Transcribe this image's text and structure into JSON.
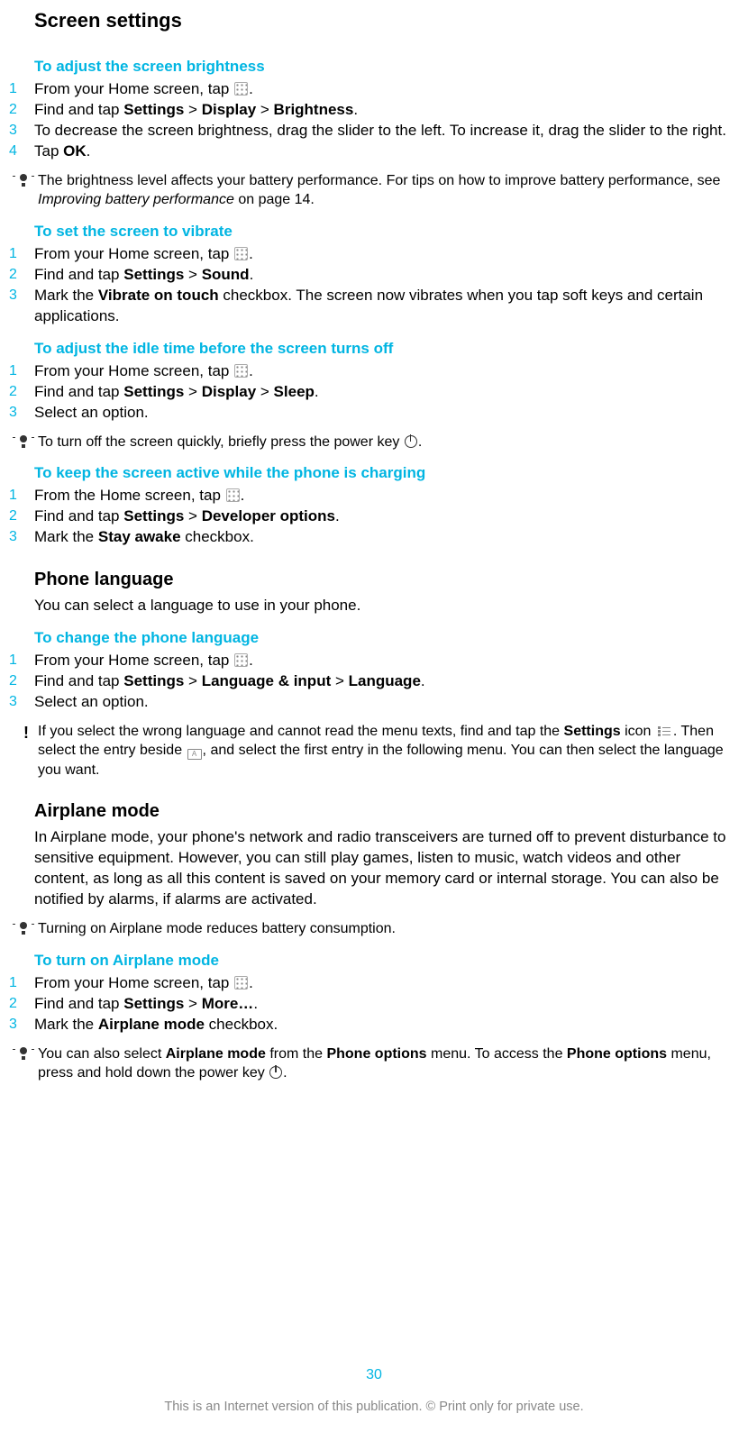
{
  "pageTitle": "Screen settings",
  "sections": [
    {
      "heading": "To adjust the screen brightness",
      "steps": [
        {
          "num": "1",
          "pre": "From your Home screen, tap ",
          "icon": "apps",
          "post": "."
        },
        {
          "num": "2",
          "html": "Find and tap <b>Settings</b> > <b>Display</b> > <b>Brightness</b>."
        },
        {
          "num": "3",
          "text": "To decrease the screen brightness, drag the slider to the left. To increase it, drag the slider to the right."
        },
        {
          "num": "4",
          "html": "Tap <b>OK</b>."
        }
      ],
      "tip": {
        "type": "bulb",
        "html": "The brightness level affects your battery performance. For tips on how to improve battery performance, see <i>Improving battery performance</i> on page 14."
      }
    },
    {
      "heading": "To set the screen to vibrate",
      "steps": [
        {
          "num": "1",
          "pre": "From your Home screen, tap ",
          "icon": "apps",
          "post": "."
        },
        {
          "num": "2",
          "html": "Find and tap <b>Settings</b> > <b>Sound</b>."
        },
        {
          "num": "3",
          "html": "Mark the <b>Vibrate on touch</b> checkbox. The screen now vibrates when you tap soft keys and certain applications."
        }
      ]
    },
    {
      "heading": "To adjust the idle time before the screen turns off",
      "steps": [
        {
          "num": "1",
          "pre": "From your Home screen, tap ",
          "icon": "apps",
          "post": "."
        },
        {
          "num": "2",
          "html": "Find and tap <b>Settings</b> > <b>Display</b> > <b>Sleep</b>."
        },
        {
          "num": "3",
          "text": "Select an option."
        }
      ],
      "tip": {
        "type": "bulb",
        "pre": "To turn off the screen quickly, briefly press the power key ",
        "icon": "power",
        "post": "."
      }
    },
    {
      "heading": "To keep the screen active while the phone is charging",
      "steps": [
        {
          "num": "1",
          "pre": "From the Home screen, tap ",
          "icon": "apps",
          "post": "."
        },
        {
          "num": "2",
          "html": "Find and tap <b>Settings</b> > <b>Developer options</b>."
        },
        {
          "num": "3",
          "html": "Mark the <b>Stay awake</b> checkbox."
        }
      ]
    }
  ],
  "phoneLang": {
    "title": "Phone language",
    "desc": "You can select a language to use in your phone.",
    "heading": "To change the phone language",
    "steps": [
      {
        "num": "1",
        "pre": "From your Home screen, tap ",
        "icon": "apps",
        "post": "."
      },
      {
        "num": "2",
        "html": "Find and tap <b>Settings</b> > <b>Language & input</b> > <b>Language</b>."
      },
      {
        "num": "3",
        "text": "Select an option."
      }
    ],
    "tip": {
      "type": "warn",
      "parts": [
        {
          "html": "If you select the wrong language and cannot read the menu texts, find and tap the <b>Settings</b> icon "
        },
        {
          "icon": "slider"
        },
        {
          "html": ". Then select the entry beside "
        },
        {
          "icon": "keyboard"
        },
        {
          "html": ", and select the first entry in the following menu. You can then select the language you want."
        }
      ]
    }
  },
  "airplane": {
    "title": "Airplane mode",
    "desc": "In Airplane mode, your phone's network and radio transceivers are turned off to prevent disturbance to sensitive equipment. However, you can still play games, listen to music, watch videos and other content, as long as all this content is saved on your memory card or internal storage. You can also be notified by alarms, if alarms are activated.",
    "tip1": {
      "type": "bulb",
      "text": "Turning on Airplane mode reduces battery consumption."
    },
    "heading": "To turn on Airplane mode",
    "steps": [
      {
        "num": "1",
        "pre": "From your Home screen, tap ",
        "icon": "apps",
        "post": "."
      },
      {
        "num": "2",
        "html": "Find and tap <b>Settings</b> > <b>More…</b>."
      },
      {
        "num": "3",
        "html": "Mark the <b>Airplane mode</b> checkbox."
      }
    ],
    "tip2": {
      "type": "bulb",
      "parts": [
        {
          "html": "You can also select <b>Airplane mode</b> from the <b>Phone options</b> menu. To access the <b>Phone options</b> menu, press and hold down the power key "
        },
        {
          "icon": "power"
        },
        {
          "html": "."
        }
      ]
    }
  },
  "pageNum": "30",
  "footer": "This is an Internet version of this publication. © Print only for private use."
}
